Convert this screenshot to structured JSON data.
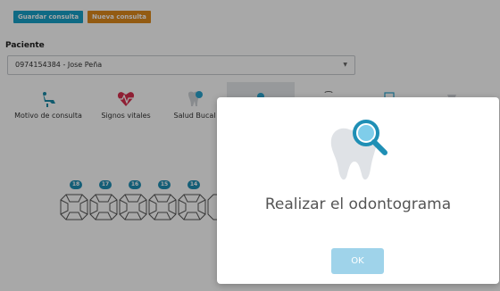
{
  "toolbar": {
    "save_label": "Guardar consulta",
    "new_label": "Nueva consulta"
  },
  "patient": {
    "label": "Paciente",
    "selected": "0974154384 - Jose Peña"
  },
  "tabs": [
    {
      "label": "Motivo de consulta",
      "icon": "dental-chair-icon"
    },
    {
      "label": "Signos vitales",
      "icon": "heartbeat-icon"
    },
    {
      "label": "Salud Bucal",
      "icon": "tooth-icon"
    },
    {
      "label": "",
      "icon": "odontogram-search-icon"
    },
    {
      "label": "",
      "icon": "tooth-outline-icon"
    },
    {
      "label": "",
      "icon": "calendar-icon"
    },
    {
      "label": "",
      "icon": "implant-icon"
    }
  ],
  "teeth": [
    {
      "number": "18"
    },
    {
      "number": "17"
    },
    {
      "number": "16"
    },
    {
      "number": "15"
    },
    {
      "number": "14"
    }
  ],
  "modal": {
    "title": "Realizar el odontograma",
    "ok_label": "OK",
    "icon": "tooth-search-icon"
  },
  "colors": {
    "save_button": "#17a2c8",
    "new_button": "#e08a1c",
    "tooth_badge": "#1f8fb5",
    "ok_button": "#9fd3ea"
  }
}
